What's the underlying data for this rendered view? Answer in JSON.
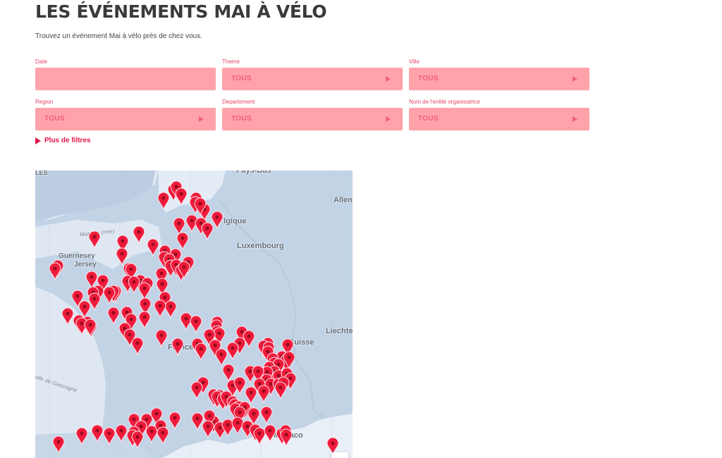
{
  "header": {
    "title": "LES ÉVÉNEMENTS MAI À VÉLO",
    "subtitle": "Trouvez un événement Mai à vélo près de chez vous."
  },
  "filters": [
    {
      "label": "Date",
      "value": ""
    },
    {
      "label": "Theme",
      "value": "TOUS"
    },
    {
      "label": "Ville",
      "value": "TOUS"
    },
    {
      "label": "Region",
      "value": "TOUS"
    },
    {
      "label": "Departement",
      "value": "TOUS"
    },
    {
      "label": "Nom de l'entité organisatrice",
      "value": "TOUS"
    }
  ],
  "more_filters": {
    "label": "Plus de filtres",
    "icon": "triangle-right-icon"
  },
  "colors": {
    "accent": "#e2164a",
    "select_bg": "#ffa2aa",
    "select_text": "#f0607a",
    "marker": "#ee1c3c",
    "map_land": "#c2d3e6",
    "map_sea": "#dfe8f2"
  },
  "map": {
    "labels": {
      "iles": "LES",
      "pays_bas": "Pays-Bas",
      "allemagne": "Allen",
      "belgique": "lgique",
      "luxembourg": "Luxembourg",
      "guernesey": "Guernesey",
      "jersey": "Jersey",
      "manche": "Manche (mer)",
      "france": "France",
      "suisse": "Suisse",
      "liechtenstein": "Liechte",
      "golfe": "olfe de Gascogne",
      "monaco": "Monaco"
    },
    "marker_icon": "map-pin-icon",
    "event_count_visible": 152
  }
}
